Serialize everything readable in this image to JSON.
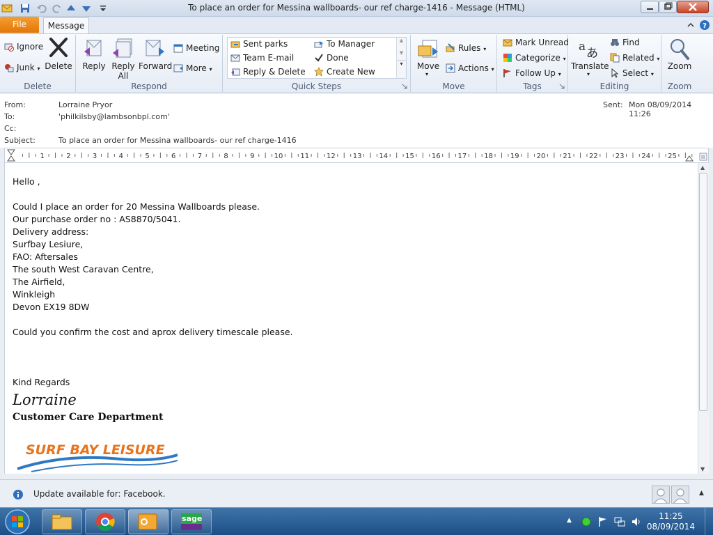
{
  "window": {
    "title": "To place an order for Messina wallboards-  our ref charge-1416  -  Message (HTML)"
  },
  "tabs": {
    "file": "File",
    "message": "Message"
  },
  "ribbon": {
    "delete_group": {
      "label": "Delete",
      "ignore": "Ignore",
      "junk": "Junk",
      "delete": "Delete"
    },
    "respond_group": {
      "label": "Respond",
      "reply": "Reply",
      "reply_all_1": "Reply",
      "reply_all_2": "All",
      "forward": "Forward",
      "meeting": "Meeting",
      "more": "More"
    },
    "quick_steps_group": {
      "label": "Quick Steps",
      "items": [
        "Sent parks",
        "To Manager",
        "Team E-mail",
        "Done",
        "Reply & Delete",
        "Create New"
      ]
    },
    "move_group": {
      "label": "Move",
      "move": "Move",
      "rules": "Rules",
      "actions": "Actions"
    },
    "tags_group": {
      "label": "Tags",
      "mark_unread": "Mark Unread",
      "categorize": "Categorize",
      "follow_up": "Follow Up"
    },
    "editing_group": {
      "label": "Editing",
      "translate": "Translate",
      "find": "Find",
      "related": "Related",
      "select": "Select"
    },
    "zoom_group": {
      "label": "Zoom",
      "zoom": "Zoom"
    }
  },
  "header": {
    "from_label": "From:",
    "from_value": "Lorraine Pryor",
    "to_label": "To:",
    "to_value": "'philkilsby@lambsonbpl.com'",
    "cc_label": "Cc:",
    "subject_label": "Subject:",
    "subject_value": "To place an order for Messina wallboards-  our ref charge-1416",
    "sent_label": "Sent:",
    "sent_value": "Mon 08/09/2014 11:26"
  },
  "ruler": {
    "numbers": [
      "1",
      "2",
      "3",
      "4",
      "5",
      "6",
      "7",
      "8",
      "9",
      "10",
      "11",
      "12",
      "13",
      "14",
      "15",
      "16",
      "17",
      "18",
      "19",
      "20",
      "21",
      "22",
      "23",
      "24",
      "25"
    ]
  },
  "body": {
    "lines": [
      "Hello ,",
      "",
      "Could I place an order for 20 Messina Wallboards please.",
      "Our purchase order no : AS8870/5041.",
      "Delivery address:",
      "Surfbay Lesiure,",
      "FAO: Aftersales",
      "The south West Caravan Centre,",
      "The Airfield,",
      "Winkleigh",
      "Devon EX19 8DW",
      "",
      "Could you confirm the cost and aprox delivery timescale please.",
      "",
      "",
      "",
      "Kind Regards"
    ],
    "signature_name": "Lorraine",
    "signature_dept": "Customer Care Department",
    "logo_text": "SURF BAY LEISURE"
  },
  "people_pane": {
    "update_text": "Update available for: Facebook."
  },
  "taskbar": {
    "time": "11:25",
    "date": "08/09/2014",
    "sage_label": "sage"
  },
  "colors": {
    "file_tab": "#e2770a",
    "logo_orange": "#e8731c",
    "logo_blue": "#2f78c4",
    "taskbar": "#1c4f86"
  }
}
